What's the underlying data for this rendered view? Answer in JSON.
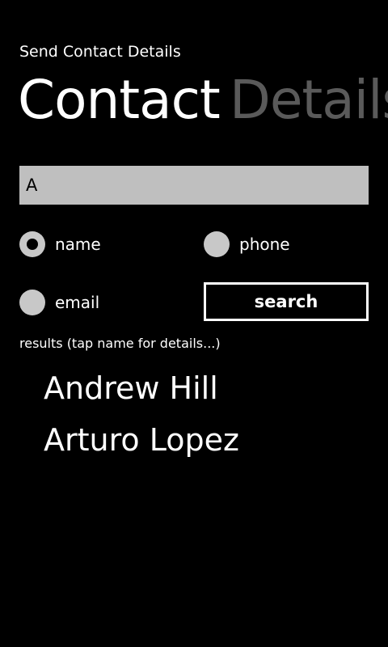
{
  "app": {
    "title": "Send Contact Details"
  },
  "pivot": {
    "peek_label": "s",
    "tabs": [
      {
        "label": "Contact",
        "active": true
      },
      {
        "label": "Details",
        "active": false
      }
    ]
  },
  "search": {
    "value": "A",
    "options": [
      {
        "label": "name",
        "checked": true
      },
      {
        "label": "phone",
        "checked": false
      },
      {
        "label": "email",
        "checked": false
      }
    ],
    "button_label": "search"
  },
  "results": {
    "caption": "results (tap name for details...)",
    "items": [
      "Andrew Hill",
      "Arturo Lopez"
    ]
  },
  "colors": {
    "background": "#000000",
    "foreground": "#ffffff",
    "inactive_tab": "#5a5a5a",
    "textbox": "#bfbfbf",
    "radio": "#c8c8c8"
  }
}
